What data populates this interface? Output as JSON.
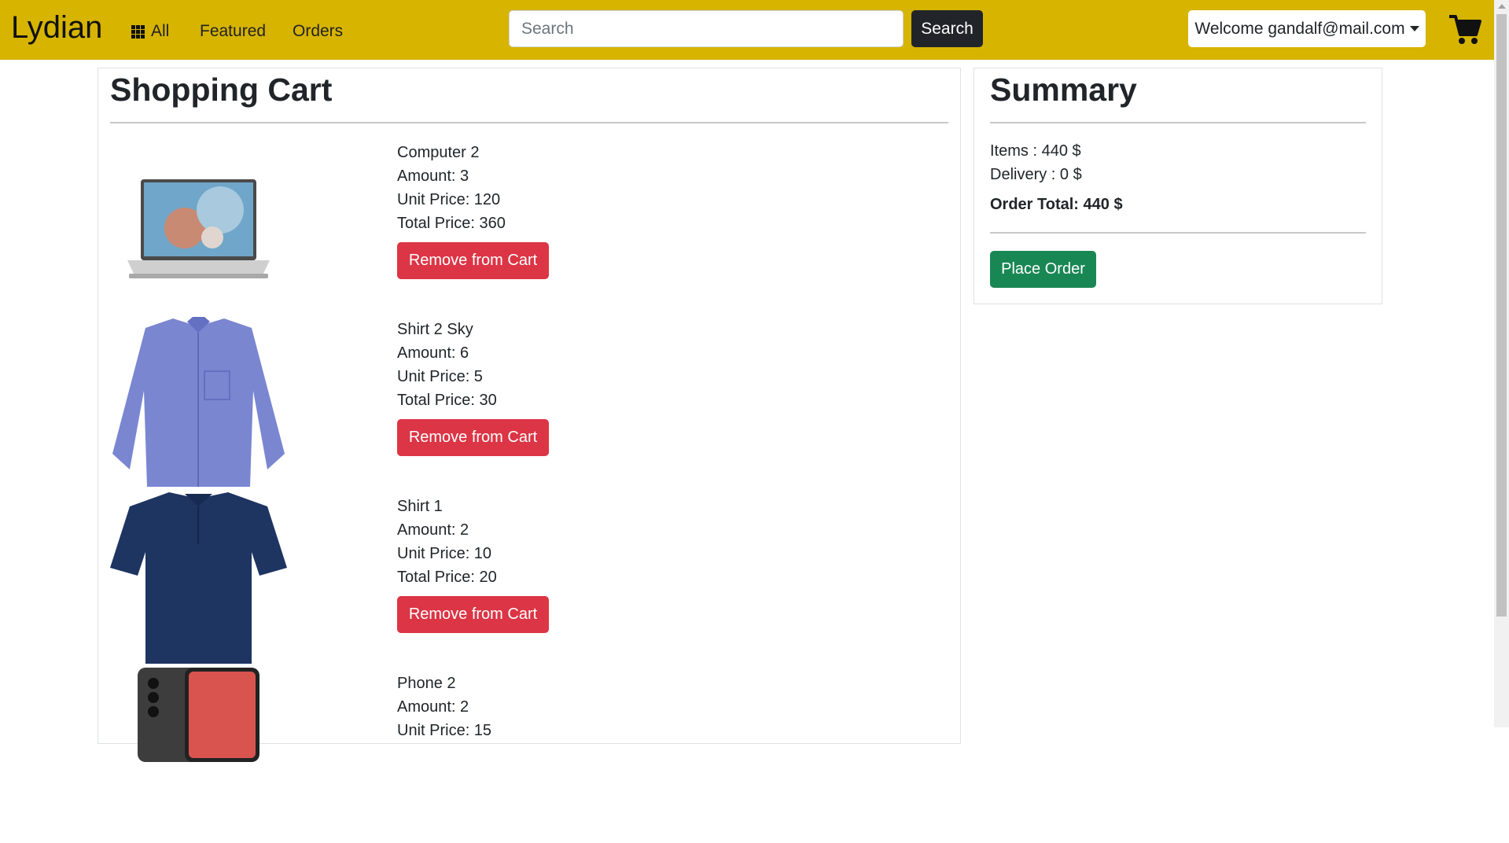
{
  "navbar": {
    "brand": "Lydian",
    "links": {
      "all": "All",
      "featured": "Featured",
      "orders": "Orders"
    },
    "search": {
      "placeholder": "Search",
      "value": "",
      "button": "Search"
    },
    "user": "Welcome gandalf@mail.com",
    "accent_color": "#d6b400"
  },
  "cart": {
    "title": "Shopping Cart",
    "items": [
      {
        "name": "Computer 2",
        "amount": "Amount: 3",
        "unit_price": "Unit Price: 120",
        "total_price": "Total Price: 360",
        "remove": "Remove from Cart",
        "image": "laptop-image"
      },
      {
        "name": "Shirt 2 Sky",
        "amount": "Amount: 6",
        "unit_price": "Unit Price: 5",
        "total_price": "Total Price: 30",
        "remove": "Remove from Cart",
        "image": "shirt-image"
      },
      {
        "name": "Shirt 1",
        "amount": "Amount: 2",
        "unit_price": "Unit Price: 10",
        "total_price": "Total Price: 20",
        "remove": "Remove from Cart",
        "image": "polo-shirt-image"
      },
      {
        "name": "Phone 2",
        "amount": "Amount: 2",
        "unit_price": "Unit Price: 15",
        "total_price": "",
        "remove": "",
        "image": "phone-image"
      }
    ]
  },
  "summary": {
    "title": "Summary",
    "items": "Items : 440 $",
    "delivery": "Delivery : 0 $",
    "order_total": "Order Total: 440 $",
    "place_order": "Place Order"
  },
  "colors": {
    "remove": "#dc3545",
    "place_order": "#198754",
    "search_button": "#212529"
  }
}
